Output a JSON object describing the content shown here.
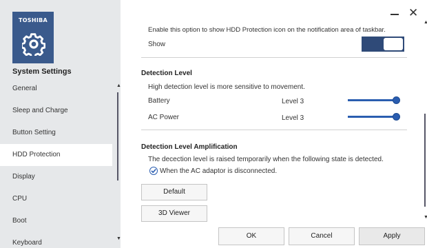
{
  "brand": {
    "logo_text": "TOSHIBA",
    "tile_color": "#3a5a8c"
  },
  "app": {
    "title": "System Settings"
  },
  "sidebar": {
    "items": [
      {
        "label": "General"
      },
      {
        "label": "Sleep and Charge"
      },
      {
        "label": "Button Setting"
      },
      {
        "label": "HDD Protection",
        "active": true
      },
      {
        "label": "Display"
      },
      {
        "label": "CPU"
      },
      {
        "label": "Boot"
      },
      {
        "label": "Keyboard"
      }
    ]
  },
  "window": {
    "close_glyph": "✕"
  },
  "main": {
    "notify_desc": "Enable this option to show HDD Protection icon on the notification area of taskbar.",
    "show_label": "Show",
    "show_toggle": "on",
    "detection": {
      "heading": "Detection Level",
      "desc": "High detection level is more sensitive to movement.",
      "rows": [
        {
          "label": "Battery",
          "value": "Level 3",
          "slider_fraction": 1.0
        },
        {
          "label": "AC Power",
          "value": "Level 3",
          "slider_fraction": 1.0
        }
      ]
    },
    "amplification": {
      "heading": "Detection Level Amplification",
      "desc": "The decection level is raised temporarily when the following state is detected.",
      "checkbox_label": "When the AC adaptor is disconnected.",
      "checked": true
    },
    "buttons": {
      "default": "Default",
      "viewer": "3D Viewer"
    }
  },
  "footer": {
    "ok": "OK",
    "cancel": "Cancel",
    "apply": "Apply"
  },
  "colors": {
    "accent": "#2a5db0",
    "sidebar_bg": "#e6e8ea",
    "toggle_bg": "#2f4a78"
  }
}
